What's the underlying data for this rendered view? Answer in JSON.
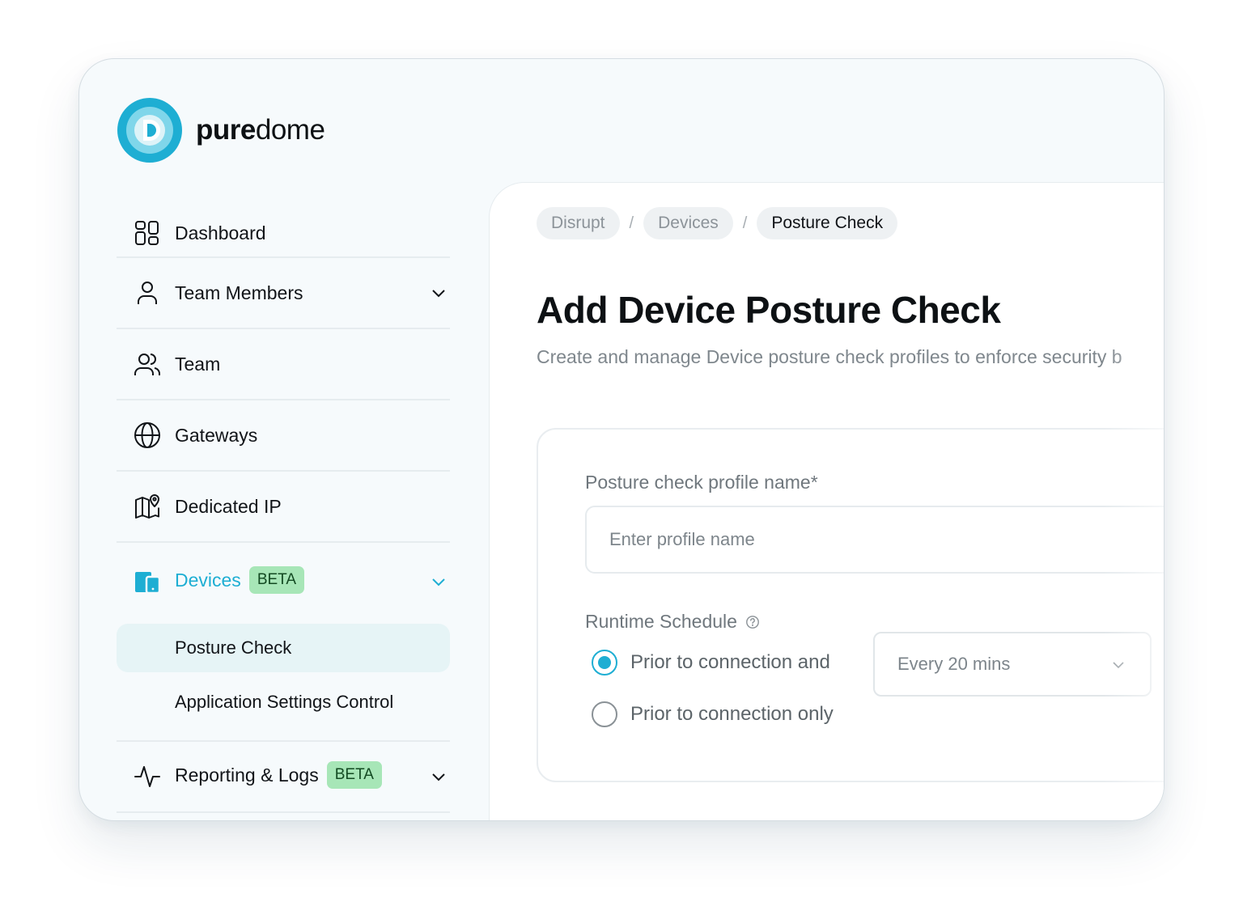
{
  "brand": {
    "name_bold": "pure",
    "name_light": "dome",
    "colors": {
      "primary": "#1EAED3",
      "light": "#7FD6EA",
      "pale": "#DDF3F8"
    }
  },
  "sidebar": {
    "items": [
      {
        "label": "Dashboard",
        "icon": "dashboard-icon"
      },
      {
        "label": "Team Members",
        "icon": "user-icon",
        "expandable": true
      },
      {
        "label": "Team",
        "icon": "users-icon"
      },
      {
        "label": "Gateways",
        "icon": "globe-icon"
      },
      {
        "label": "Dedicated IP",
        "icon": "map-pin-icon"
      },
      {
        "label": "Devices",
        "icon": "devices-icon",
        "badge": "BETA",
        "expandable": true,
        "active": true
      },
      {
        "label": "Reporting & Logs",
        "icon": "activity-icon",
        "badge": "BETA",
        "expandable": true
      }
    ],
    "devices_sub": [
      {
        "label": "Posture Check",
        "selected": true
      },
      {
        "label": "Application Settings Control",
        "selected": false
      }
    ]
  },
  "breadcrumb": [
    "Disrupt",
    "Devices",
    "Posture Check"
  ],
  "breadcrumb_separator": "/",
  "page": {
    "title": "Add Device Posture Check",
    "subtitle": "Create and manage Device posture check profiles to enforce security b"
  },
  "form": {
    "profile_name": {
      "label": "Posture check profile name*",
      "placeholder": "Enter profile name",
      "value": ""
    },
    "runtime_schedule": {
      "label": "Runtime Schedule",
      "options": [
        {
          "label": "Prior to connection and",
          "checked": true
        },
        {
          "label": "Prior to connection only",
          "checked": false
        }
      ],
      "interval": "Every 20 mins"
    }
  },
  "colors": {
    "accent": "#1EAED3",
    "badge_bg": "#A7E6B7",
    "badge_text": "#134A22"
  }
}
